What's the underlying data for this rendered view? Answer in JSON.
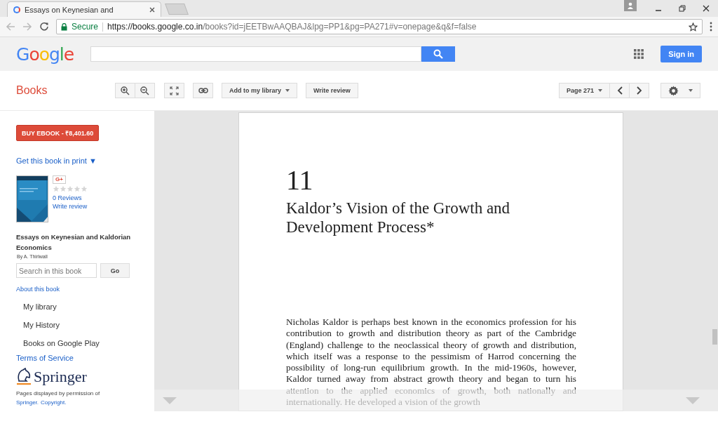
{
  "browser": {
    "tabs": [
      {
        "title": "Essays on Keynesian and",
        "selected": true
      }
    ],
    "security_label": "Secure",
    "url": {
      "host": "https://books.google.co.in",
      "path": "/books?id=jEETBwAAQBAJ&lpg=PP1&pg=PA271#v=onepage&q&f=false"
    }
  },
  "header": {
    "logo": "Google",
    "sign_in": "Sign in"
  },
  "toolbar": {
    "title": "Books",
    "add_to_library": "Add to my library",
    "write_review": "Write review",
    "page": "Page 271"
  },
  "sidebar": {
    "buy_button": "BUY EBOOK - ₹8,401.60",
    "get_in_print": "Get this book in print ▼",
    "gplus": "G+",
    "stars": 0,
    "reviews": "0 Reviews",
    "write_review": "Write review",
    "book_title": "Essays on Keynesian and Kaldorian Economics",
    "author": "By A. Thirlwall",
    "search_placeholder": "Search in this book",
    "go": "Go",
    "about": "About this book",
    "links": [
      "My library",
      "My History",
      "Books on Google Play"
    ],
    "terms": "Terms of Service",
    "publisher": "Springer",
    "permission": "Pages displayed by permission of",
    "permission_links": [
      "Springer.",
      "Copyright."
    ]
  },
  "page": {
    "chapter_number": "11",
    "chapter_title": "Kaldor’s Vision of the Growth and Development Process*",
    "paragraph": "Nicholas Kaldor is perhaps best known in the economics profession for his contribution to growth and distribution theory as part of the Cambridge (England) challenge to the neoclassical theory of growth and distribution, which itself was a response to the pessimism of Harrod concerning the possibility of long-run equilibrium growth. In the mid-1960s, however, Kaldor turned away from abstract growth theory and began to turn his attention to the applied economics of growth, both nationally and internationally. He developed a vision of the growth"
  }
}
